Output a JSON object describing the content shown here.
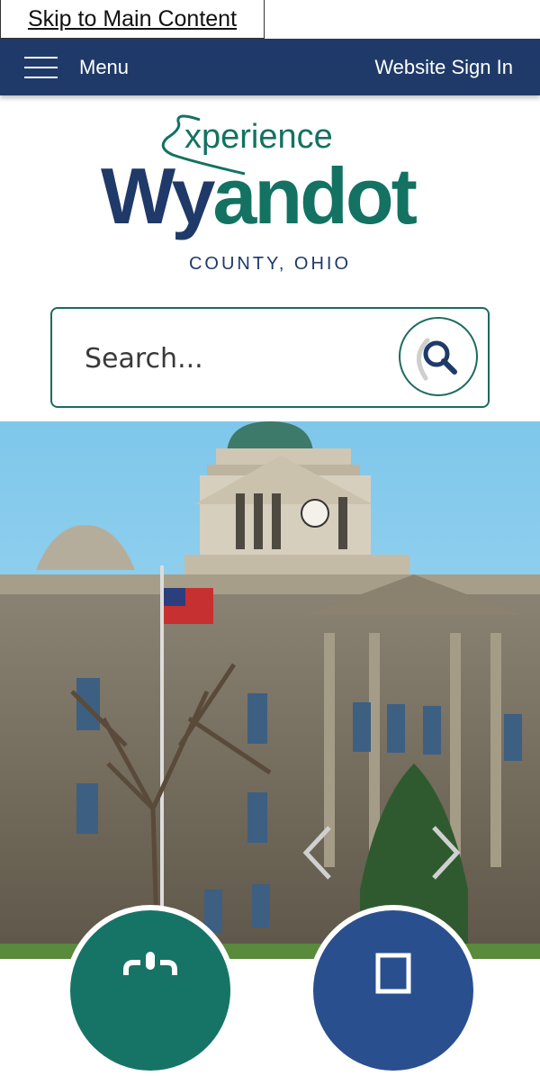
{
  "skip_link": "Skip to Main Content",
  "topbar": {
    "menu_label": "Menu",
    "menu_icon": "hamburger-icon",
    "signin_label": "Website Sign In",
    "background": "#1f3a68"
  },
  "logo": {
    "line1": "xperience",
    "line2_dark": "Wy",
    "line2_green": "andot",
    "line3": "COUNTY, OHIO",
    "colors": {
      "navy": "#1f3a68",
      "teal": "#137261"
    }
  },
  "search": {
    "placeholder": "Search...",
    "button_icon": "magnifier-icon",
    "border_color": "#1c6c5f"
  },
  "hero": {
    "image": "county-courthouse-photo",
    "prev_icon": "chevron-left-icon",
    "next_icon": "chevron-right-icon"
  },
  "quick_links": [
    {
      "icon": "link-icon",
      "color": "#167466"
    },
    {
      "icon": "document-icon",
      "color": "#2a4f8f"
    }
  ]
}
